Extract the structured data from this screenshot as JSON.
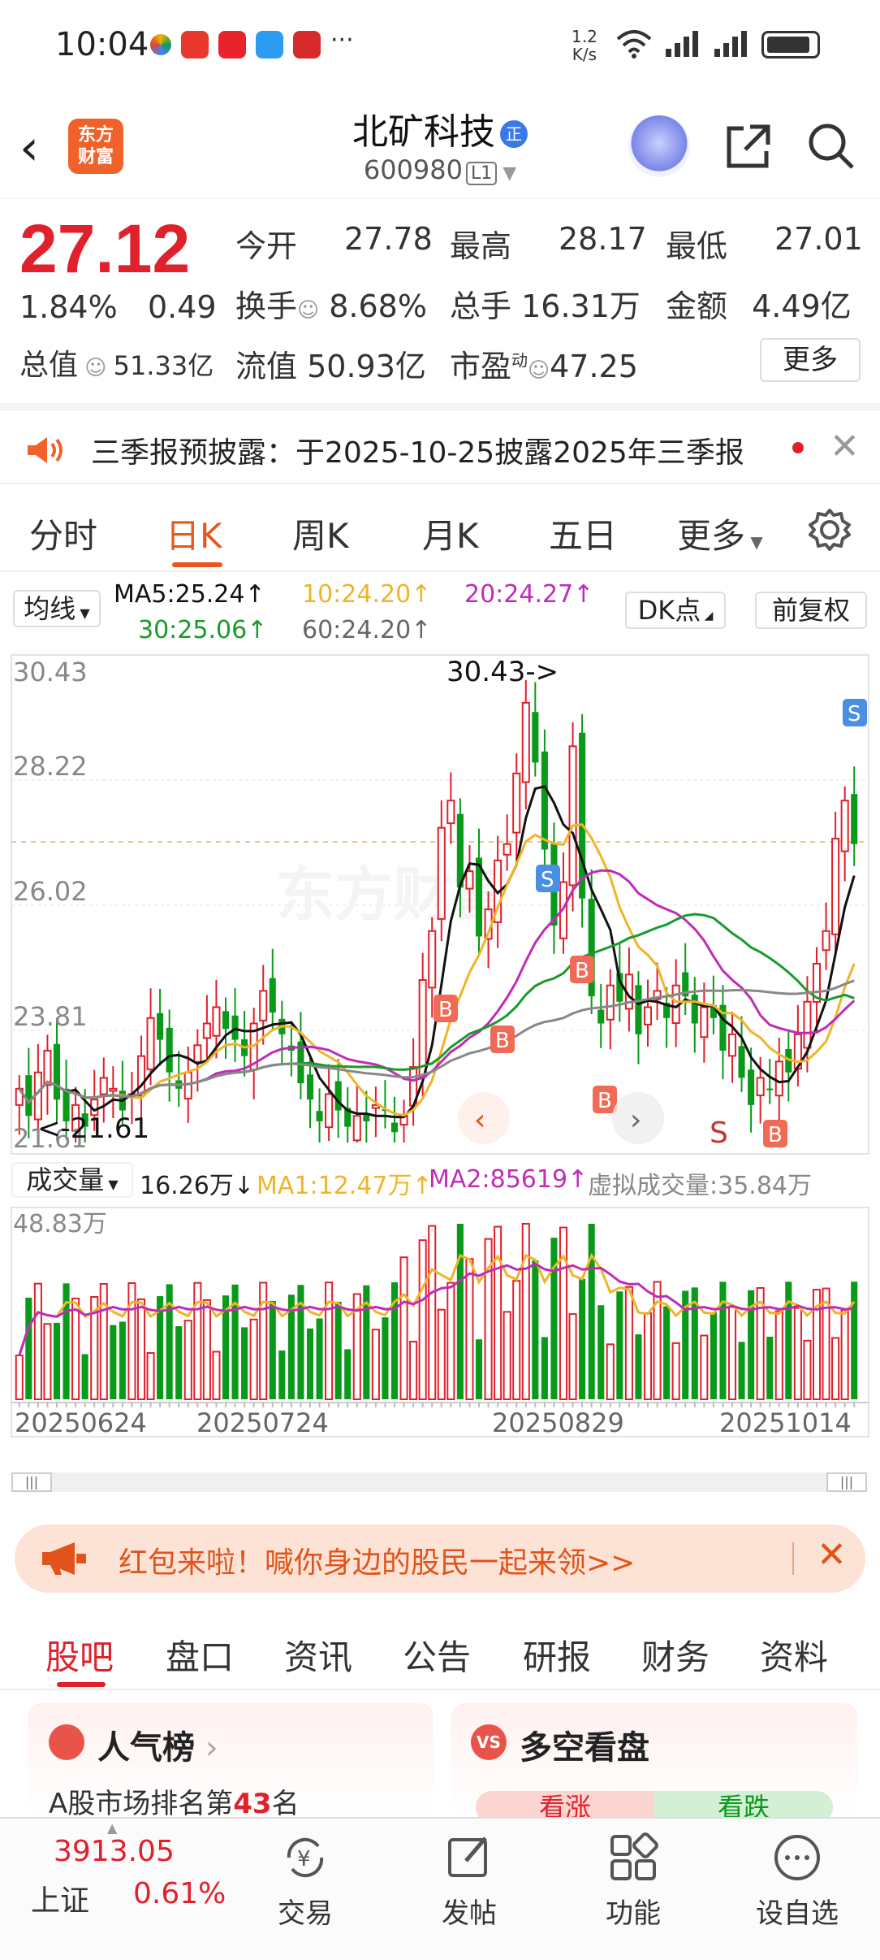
{
  "status_bar": {
    "time": "10:04",
    "net_speed_value": "1.2",
    "net_speed_unit": "K/s"
  },
  "header": {
    "app_logo": "东方\n财富",
    "stock_name": "北矿科技",
    "name_badge": "正",
    "stock_code": "600980",
    "level": "L1"
  },
  "quote": {
    "price": "27.12",
    "change_pct": "1.84%",
    "change": "0.49",
    "open_label": "今开",
    "open": "27.78",
    "high_label": "最高",
    "high": "28.17",
    "low_label": "最低",
    "low": "27.01",
    "turnover_label": "换手",
    "turnover": "8.68%",
    "volume_label": "总手",
    "volume": "16.31万",
    "amount_label": "金额",
    "amount": "4.49亿",
    "mktcap_label": "总值",
    "mktcap": "51.33亿",
    "float_label": "流值",
    "float": "50.93亿",
    "pe_label": "市盈",
    "pe_sup": "动",
    "pe": "47.25",
    "more_label": "更多"
  },
  "notice": {
    "text": "三季报预披露：于2025-10-25披露2025年三季报"
  },
  "tabs": [
    "分时",
    "日K",
    "周K",
    "月K",
    "五日",
    "更多"
  ],
  "ma_legend": {
    "selector": "均线",
    "ma5": "MA5:25.24↑",
    "ma10": "10:24.20↑",
    "ma20": "20:24.27↑",
    "ma30": "30:25.06↑",
    "ma60": "60:24.20↑",
    "dk_label": "DK点",
    "adjust_label": "前复权"
  },
  "colors": {
    "up": "#e0202b",
    "down": "#0a9a1a",
    "ma5": "#111111",
    "ma10": "#f0b428",
    "ma20": "#c02cb8",
    "ma30": "#1a9a2a",
    "ma60": "#888888",
    "accent": "#e8581c"
  },
  "price_axis": [
    "30.43",
    "28.22",
    "26.02",
    "23.81",
    "21.61"
  ],
  "annotations": {
    "high_marker": "30.43->",
    "low_marker": "<-21.61",
    "buy": "B",
    "sell": "S",
    "watermark": "东方财富"
  },
  "volume_legend": {
    "selector": "成交量",
    "volume": "16.26万↓",
    "ma1": "MA1:12.47万↑",
    "ma2": "MA2:85619↑",
    "virtual": "虚拟成交量:35.84万",
    "max_label": "48.83万"
  },
  "date_axis": [
    "20250624",
    "20250724",
    "20250829",
    "20251014"
  ],
  "red_packet": {
    "text": "红包来啦！喊你身边的股民一起来领>>"
  },
  "bottom_tabs": [
    "股吧",
    "盘口",
    "资讯",
    "公告",
    "研报",
    "财务",
    "资料"
  ],
  "cards": {
    "popular_title": "人气榜",
    "popular_rank_prefix": "A股市场排名第",
    "popular_rank": "43",
    "popular_rank_suffix": "名",
    "vs_title": "多空看盘",
    "bull": "看涨",
    "bear": "看跌"
  },
  "footer": {
    "index_value": "3913.05",
    "index_name": "上证",
    "index_change": "0.61%",
    "trade": "交易",
    "post": "发帖",
    "function": "功能",
    "watchlist": "设自选"
  }
}
